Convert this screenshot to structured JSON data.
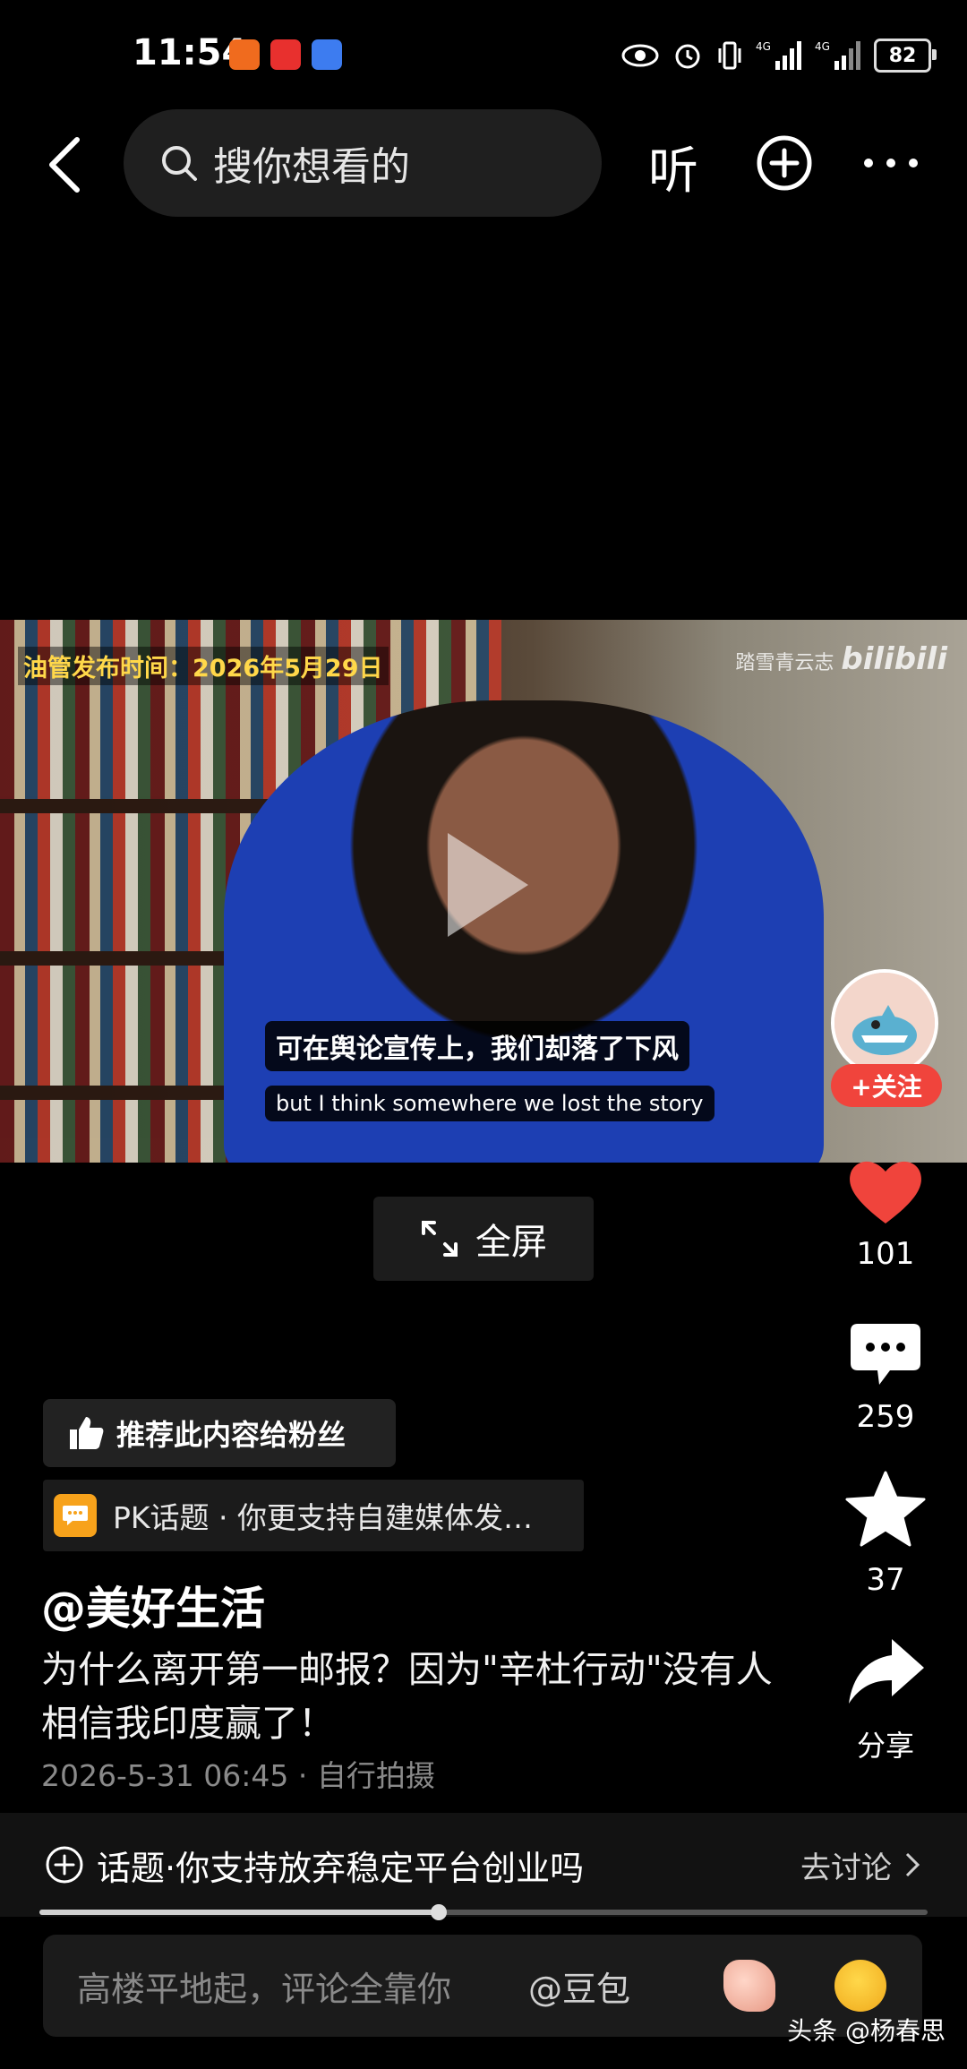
{
  "status": {
    "time": "11:54",
    "battery": "82"
  },
  "topbar": {
    "search_placeholder": "搜你想看的",
    "listen_label": "听"
  },
  "video": {
    "publish_tag": "油管发布时间：2026年5月29日",
    "watermark_text": "踏雪青云志",
    "watermark_brand": "bilibili",
    "subtitle_cn": "可在舆论宣传上，我们却落了下风",
    "subtitle_en": "but I think somewhere we lost the story",
    "progress": 0.45
  },
  "fullscreen_label": "全屏",
  "rail": {
    "follow_label": "+关注",
    "likes": "101",
    "comments": "259",
    "favorites": "37",
    "share_label": "分享"
  },
  "recommend_label": "推荐此内容给粉丝",
  "pk_topic": "PK话题 · 你更支持自建媒体发…",
  "author": "@美好生活",
  "description": "为什么离开第一邮报？因为\"辛杜行动\"没有人相信我印度赢了！",
  "meta": "2026-5-31 06:45 · 自行拍摄",
  "topic": {
    "text": "话题·你支持放弃稳定平台创业吗",
    "action": "去讨论"
  },
  "comment": {
    "placeholder": "高楼平地起，评论全靠你",
    "mention": "@豆包"
  },
  "credit": "头条 @杨春思",
  "colors": {
    "like": "#f0443c",
    "follow": "#f0443c",
    "pk_icon": "#f7a21b"
  }
}
